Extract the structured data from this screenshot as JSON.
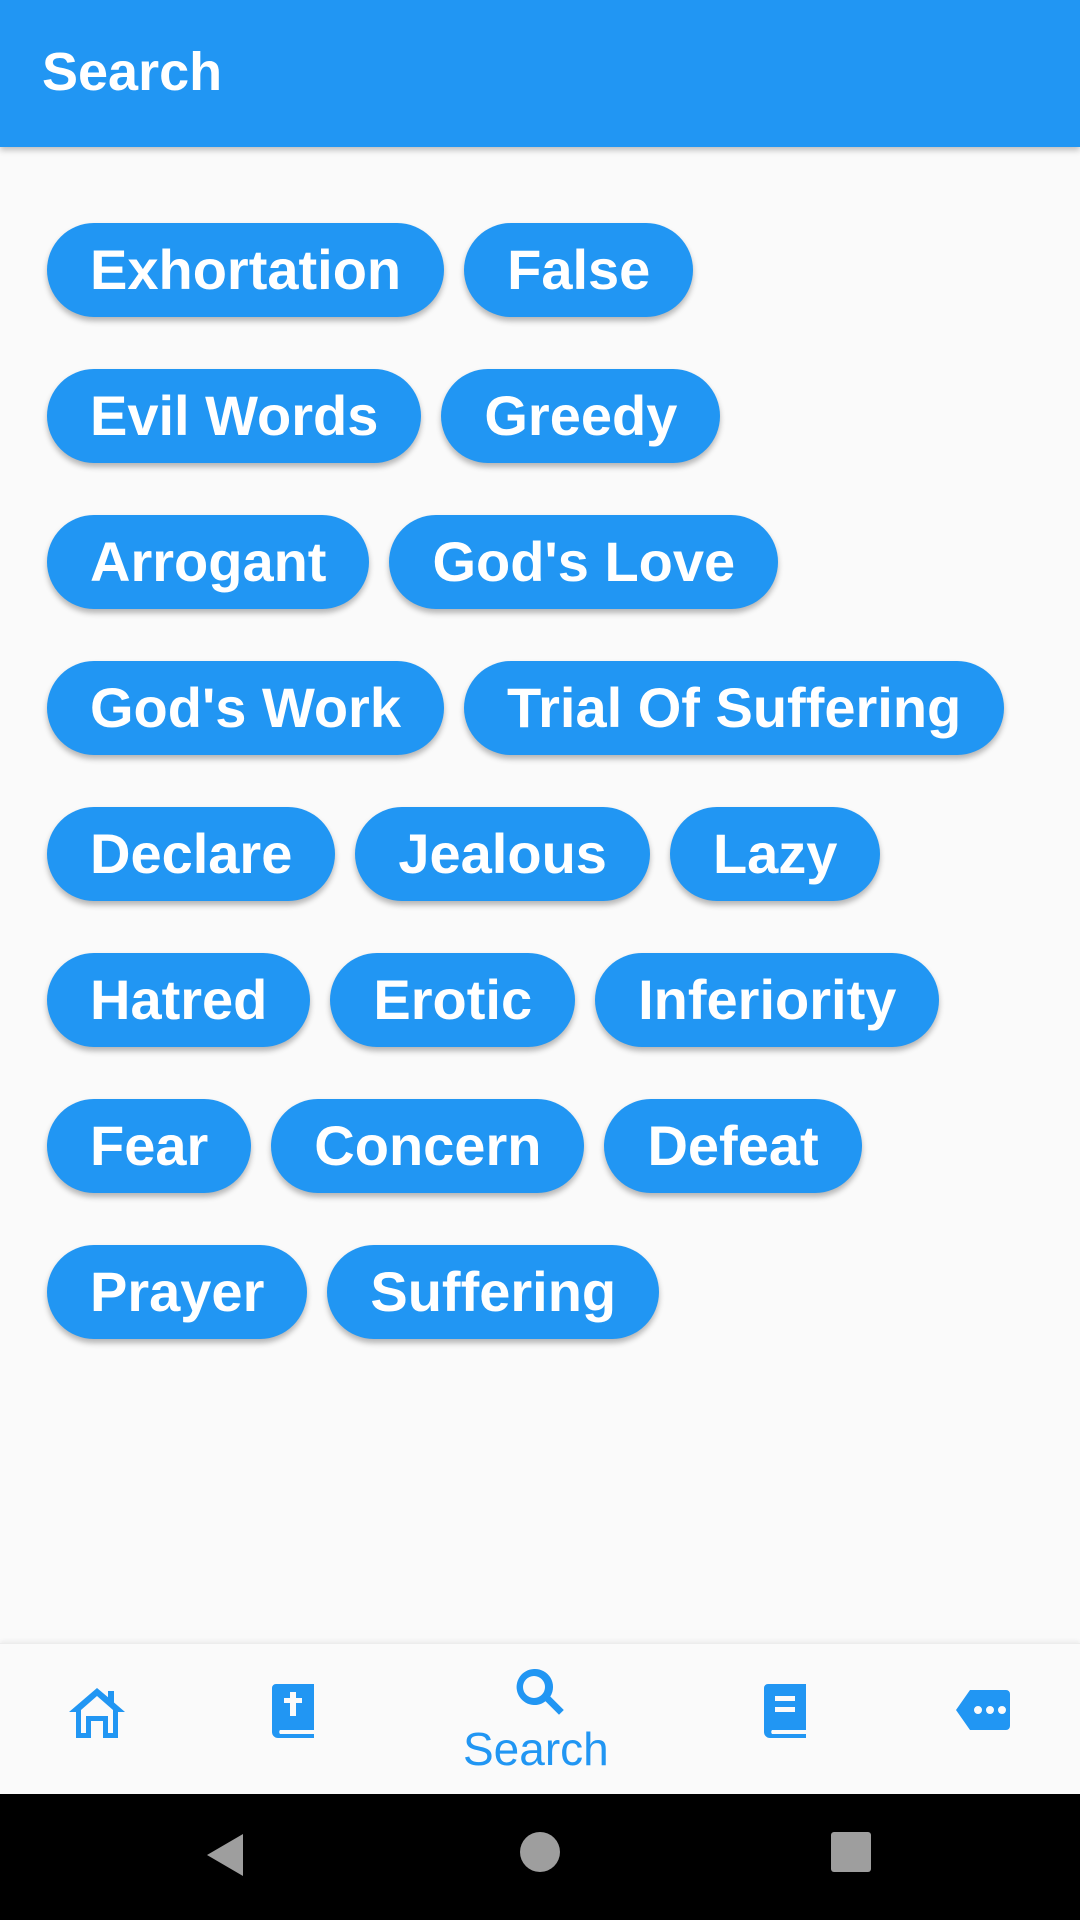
{
  "app_bar": {
    "title": "Search"
  },
  "tags": {
    "rows": [
      [
        "Exhortation",
        "False"
      ],
      [
        "Evil Words",
        "Greedy"
      ],
      [
        "Arrogant",
        "God's Love"
      ],
      [
        "God's Work",
        "Trial Of Suffering"
      ],
      [
        "Declare",
        "Jealous",
        "Lazy"
      ],
      [
        "Hatred",
        "Erotic",
        "Inferiority"
      ],
      [
        "Fear",
        "Concern",
        "Defeat"
      ],
      [
        "Prayer",
        "Suffering"
      ]
    ]
  },
  "bottom_nav": {
    "items": [
      {
        "icon": "home-icon",
        "label": ""
      },
      {
        "icon": "bible-icon",
        "label": ""
      },
      {
        "icon": "search-icon",
        "label": "Search",
        "active": true
      },
      {
        "icon": "book-icon",
        "label": ""
      },
      {
        "icon": "chat-more-icon",
        "label": ""
      }
    ]
  },
  "system_nav": {
    "buttons": [
      "back-icon",
      "home-circle-icon",
      "recents-icon"
    ]
  },
  "colors": {
    "primary": "#2196f3",
    "background": "#fafafa",
    "chip_text": "#ffffff",
    "system_bar": "#000000"
  }
}
